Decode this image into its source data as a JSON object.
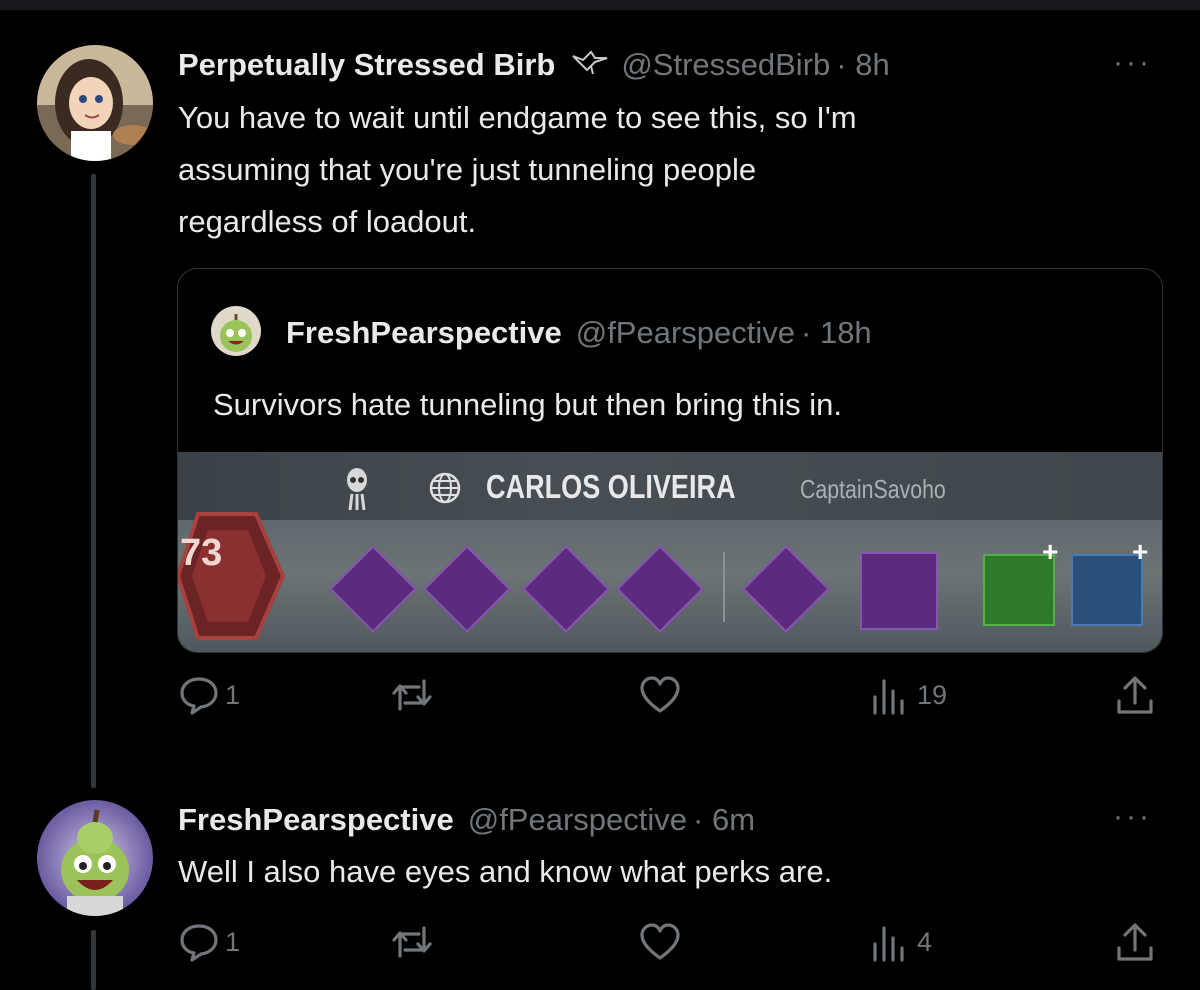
{
  "tweet": {
    "name": "Perpetually Stressed Birb",
    "handle": "@StressedBirb",
    "time": "· 8h",
    "text_lines": [
      "You have to wait until endgame to see this, so I'm",
      "assuming that you're just tunneling people",
      "regardless of loadout."
    ],
    "more": "···",
    "actions": {
      "replies": "1",
      "retweets": "",
      "likes": "",
      "views": "19"
    }
  },
  "quote": {
    "name": "FreshPearspective",
    "handle": "@fPearspective",
    "time": "· 18h",
    "text": "Survivors hate tunneling but then bring this in.",
    "game": {
      "player_name": "CARLOS OLIVEIRA",
      "player_tag": "CaptainSavoho",
      "level": "73"
    }
  },
  "reply": {
    "name": "FreshPearspective",
    "handle": "@fPearspective",
    "time": "· 6m",
    "text": "Well I also have eyes and know what perks are.",
    "more": "···",
    "actions": {
      "replies": "1",
      "retweets": "",
      "likes": "",
      "views": "4"
    }
  },
  "icons": {
    "verified_bird": "bird-icon",
    "reply": "reply-icon",
    "retweet": "retweet-icon",
    "like": "heart-icon",
    "views": "views-icon",
    "share": "share-icon",
    "globe": "globe-icon",
    "skull": "skull-icon"
  },
  "colors": {
    "background": "#000000",
    "text": "#e7e9ea",
    "muted": "#71767b",
    "perk_purple": "#5b2c7d"
  }
}
